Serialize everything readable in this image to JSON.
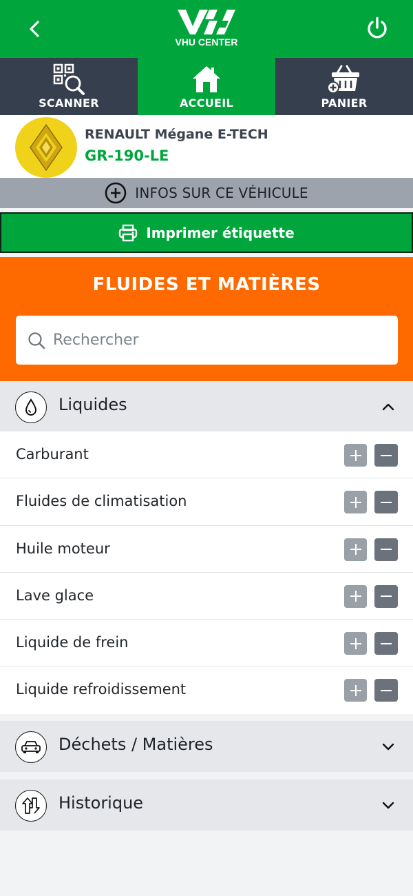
{
  "brand": {
    "logo_text": "VHU CENTER"
  },
  "nav": [
    {
      "label": "SCANNER",
      "icon": "qr-scanner-icon",
      "active": false
    },
    {
      "label": "ACCUEIL",
      "icon": "home-icon",
      "active": true
    },
    {
      "label": "PANIER",
      "icon": "basket-icon",
      "active": false
    }
  ],
  "vehicle": {
    "name": "RENAULT Mégane E-TECH",
    "plate": "GR-190-LE",
    "brand_icon": "renault-logo"
  },
  "infos_label": "INFOS SUR CE VÉHICULE",
  "print_label": "Imprimer étiquette",
  "section_title": "FLUIDES ET MATIÈRES",
  "search": {
    "placeholder": "Rechercher",
    "value": ""
  },
  "accordion": {
    "liquides": {
      "label": "Liquides",
      "icon": "drop-icon",
      "expanded": true,
      "items": [
        "Carburant",
        "Fluides de climatisation",
        "Huile moteur",
        "Lave glace",
        "Liquide de frein",
        "Liquide refroidissement"
      ]
    },
    "dechets": {
      "label": "Déchets / Matières",
      "icon": "car-icon",
      "expanded": false
    },
    "historique": {
      "label": "Historique",
      "icon": "up-down-arrows-icon",
      "expanded": false
    }
  },
  "colors": {
    "primary_green": "#00a63c",
    "nav_dark": "#363f4d",
    "accent_orange": "#ff6a00",
    "plate_green": "#00a63c",
    "renault_yellow": "#f0d21b"
  }
}
